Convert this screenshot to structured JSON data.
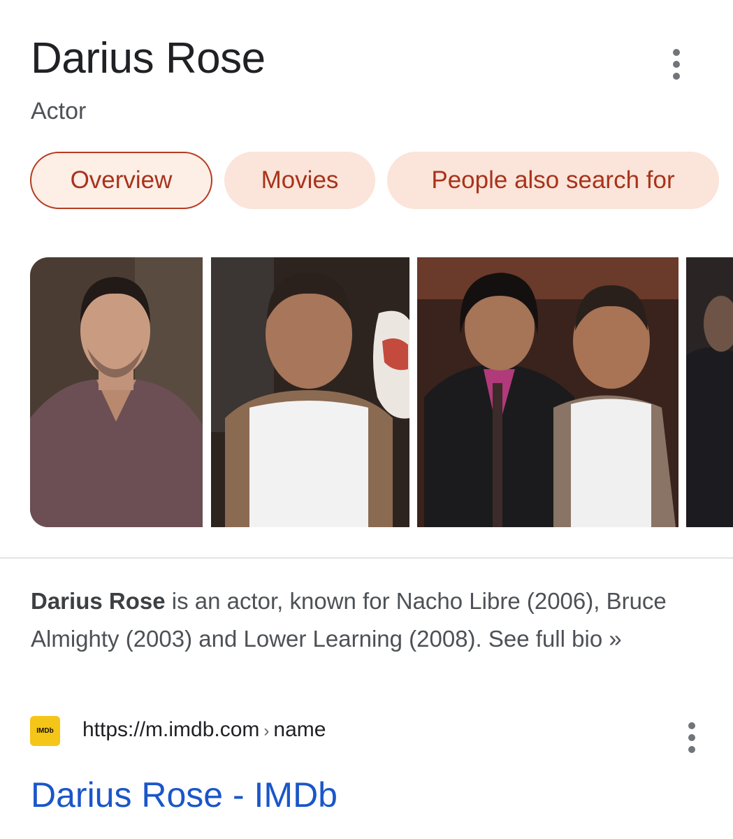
{
  "entity": {
    "name": "Darius Rose",
    "description": "Actor"
  },
  "tabs": [
    {
      "label": "Overview",
      "active": true
    },
    {
      "label": "Movies",
      "active": false
    },
    {
      "label": "People also search for",
      "active": false
    }
  ],
  "bio": {
    "name": "Darius Rose",
    "text": " is an actor, known for Nacho Libre (2006), Bruce Almighty (2003) and Lower Learning (2008). ",
    "link": "See full bio »"
  },
  "result": {
    "favicon_text": "IMDb",
    "url": "https://m.imdb.com",
    "url_separator": "›",
    "url_path": "name",
    "title": "Darius Rose - IMDb"
  },
  "colors": {
    "chip_bg": "#fbe4d9",
    "chip_text": "#a8331b",
    "link_blue": "#1a56c9",
    "imdb_yellow": "#f5c518"
  },
  "icons": [
    "more-vert-icon",
    "imdb-favicon"
  ]
}
